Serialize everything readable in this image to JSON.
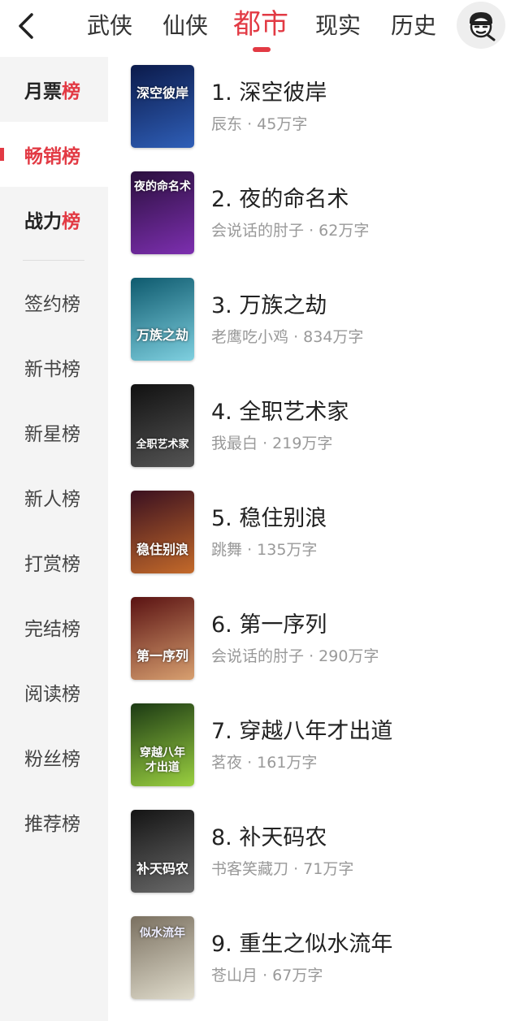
{
  "header": {
    "tabs": [
      {
        "label": "武侠",
        "active": false
      },
      {
        "label": "仙侠",
        "active": false
      },
      {
        "label": "都市",
        "active": true
      },
      {
        "label": "现实",
        "active": false
      },
      {
        "label": "历史",
        "active": false
      }
    ]
  },
  "sidebar": {
    "items": [
      {
        "prefix": "月票",
        "suffix": "榜",
        "active": false
      },
      {
        "prefix": "畅销榜",
        "suffix": "",
        "active": true
      },
      {
        "prefix": "战力",
        "suffix": "榜",
        "active": false
      },
      {
        "label": "签约榜"
      },
      {
        "label": "新书榜"
      },
      {
        "label": "新星榜"
      },
      {
        "label": "新人榜"
      },
      {
        "label": "打赏榜"
      },
      {
        "label": "完结榜"
      },
      {
        "label": "阅读榜"
      },
      {
        "label": "粉丝榜"
      },
      {
        "label": "推荐榜"
      }
    ]
  },
  "books": [
    {
      "rank": "1.",
      "title": "深空彼岸",
      "author": "辰东",
      "words": "45万字",
      "cover_text": "深空彼岸",
      "cover_colors": [
        "#0b1a4a",
        "#2f5fb8"
      ]
    },
    {
      "rank": "2.",
      "title": "夜的命名术",
      "author": "会说话的肘子",
      "words": "62万字",
      "cover_text": "夜的命名术",
      "cover_colors": [
        "#2a0f3d",
        "#7d2fb0"
      ]
    },
    {
      "rank": "3.",
      "title": "万族之劫",
      "author": "老鹰吃小鸡",
      "words": "834万字",
      "cover_text": "万族之劫",
      "cover_colors": [
        "#0e5a6e",
        "#7fd0e0"
      ]
    },
    {
      "rank": "4.",
      "title": "全职艺术家",
      "author": "我最白",
      "words": "219万字",
      "cover_text": "全职艺术家",
      "cover_colors": [
        "#111111",
        "#555555"
      ]
    },
    {
      "rank": "5.",
      "title": "稳住别浪",
      "author": "跳舞",
      "words": "135万字",
      "cover_text": "稳住别浪",
      "cover_colors": [
        "#3a1020",
        "#c46a2a"
      ]
    },
    {
      "rank": "6.",
      "title": "第一序列",
      "author": "会说话的肘子",
      "words": "290万字",
      "cover_text": "第一序列",
      "cover_colors": [
        "#5a1212",
        "#d8a070"
      ]
    },
    {
      "rank": "7.",
      "title": "穿越八年才出道",
      "author": "茗夜",
      "words": "161万字",
      "cover_text": "穿越八年才出道",
      "cover_colors": [
        "#1c3a14",
        "#9ad040"
      ]
    },
    {
      "rank": "8.",
      "title": "补天码农",
      "author": "书客笑藏刀",
      "words": "71万字",
      "cover_text": "补天码农",
      "cover_colors": [
        "#141414",
        "#6a6a6a"
      ]
    },
    {
      "rank": "9.",
      "title": "重生之似水流年",
      "author": "苍山月",
      "words": "67万字",
      "cover_text": "似水流年",
      "cover_colors": [
        "#7a7060",
        "#e0dccc"
      ]
    }
  ],
  "meta_separator": "·",
  "colors": {
    "accent": "#e23a44",
    "sidebar_bg": "#f4f4f4",
    "meta": "#999999"
  }
}
